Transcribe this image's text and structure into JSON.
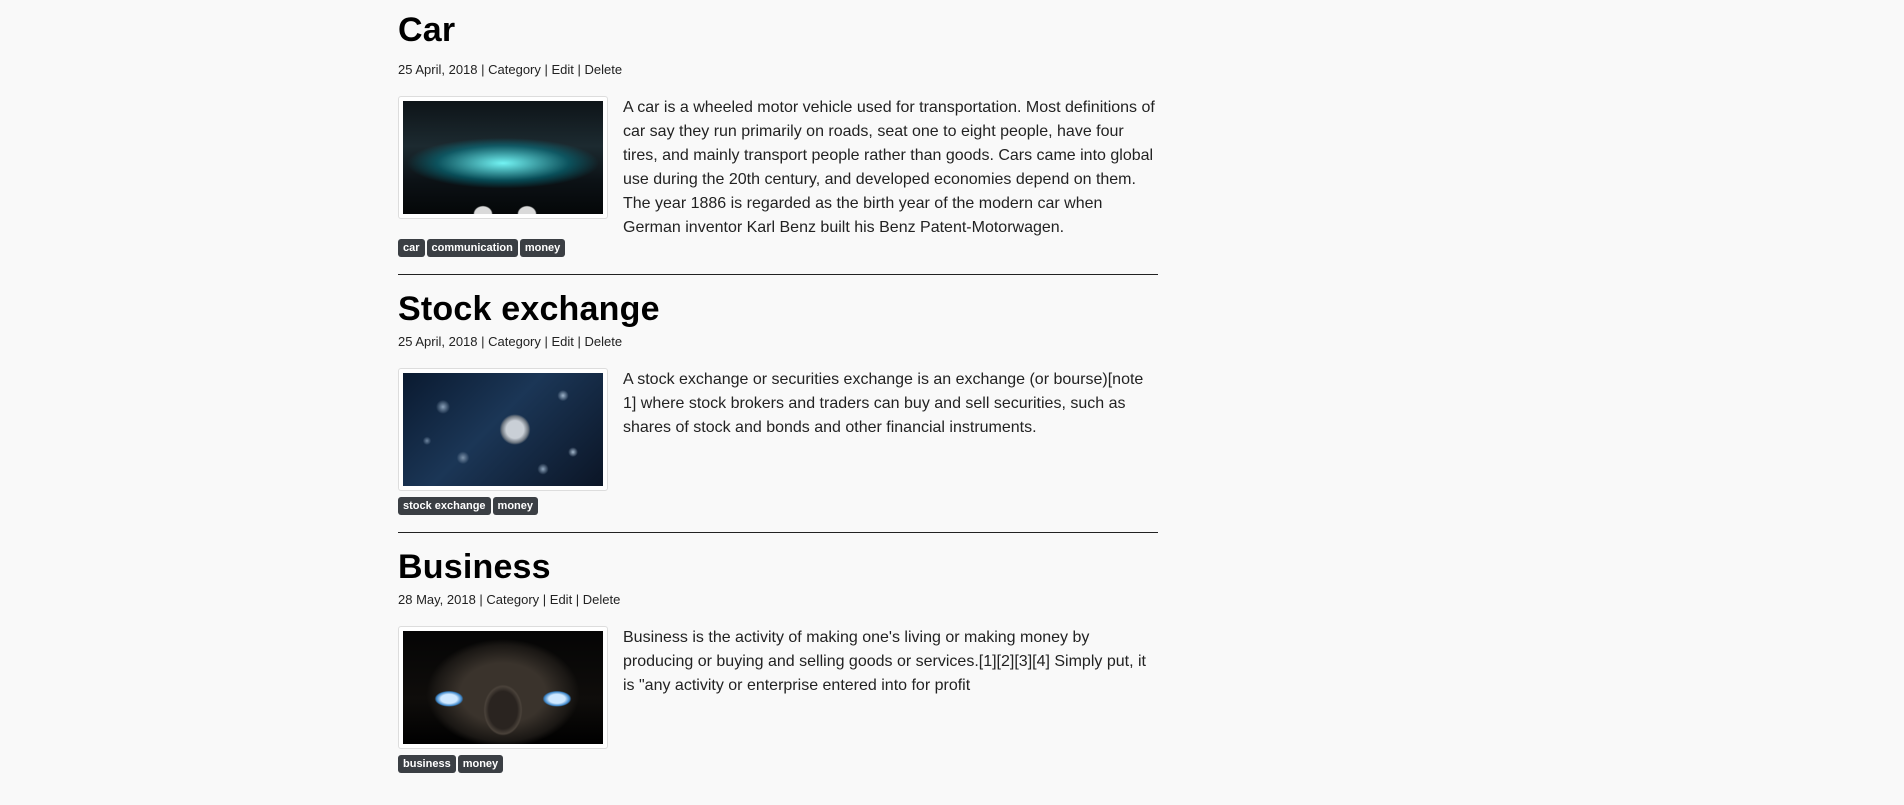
{
  "posts": [
    {
      "title": "Car",
      "date": "25 April, 2018",
      "category_label": "Category",
      "edit_label": "Edit",
      "delete_label": "Delete",
      "separator": " | ",
      "image": "car-engine-image",
      "text": "A car is a wheeled motor vehicle used for transportation. Most definitions of car say they run primarily on roads, seat one to eight people, have four tires, and mainly transport people rather than goods. Cars came into global use during the 20th century, and developed economies depend on them. The year 1886 is regarded as the birth year of the modern car when German inventor Karl Benz built his Benz Patent-Motorwagen.",
      "tags": [
        "car",
        "communication",
        "money"
      ]
    },
    {
      "title": "Stock exchange",
      "date": "25 April, 2018",
      "category_label": "Category",
      "edit_label": "Edit",
      "delete_label": "Delete",
      "separator": " | ",
      "image": "watch-parts-image",
      "text": "A stock exchange or securities exchange is an exchange (or bourse)[note 1] where stock brokers and traders can buy and sell securities, such as shares of stock and bonds and other financial instruments.",
      "tags": [
        "stock exchange",
        "money"
      ]
    },
    {
      "title": "Business",
      "date": "28 May, 2018",
      "category_label": "Category",
      "edit_label": "Edit",
      "delete_label": "Delete",
      "separator": " | ",
      "image": "sports-car-image",
      "text": "Business is the activity of making one's living or making money by producing or buying and selling goods or services.[1][2][3][4] Simply put, it is \"any activity or enterprise entered into for profit",
      "tags": [
        "business",
        "money"
      ]
    }
  ],
  "colors": {
    "background": "#f9f9f9",
    "tag_background": "#3b3f44",
    "tag_text": "#ffffff",
    "divider": "#222222"
  }
}
